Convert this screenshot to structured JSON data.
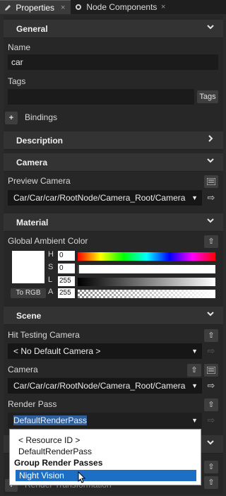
{
  "tabs": [
    {
      "icon": "wrench-icon",
      "label": "Properties",
      "close": "×"
    },
    {
      "icon": "settings-icon",
      "label": "Node Components",
      "close": "×"
    }
  ],
  "sections": {
    "general": "General",
    "description": "Description",
    "camera": "Camera",
    "material": "Material",
    "scene": "Scene"
  },
  "general": {
    "name_label": "Name",
    "name_value": "car",
    "tags_label": "Tags",
    "tags_value": "",
    "tags_button": "Tags",
    "bindings_add": "+",
    "bindings_label": "Bindings"
  },
  "camera": {
    "preview_label": "Preview Camera",
    "preview_value": "Car/Car/car/RootNode/Camera_Root/Camera"
  },
  "material": {
    "ambient_label": "Global Ambient Color",
    "to_rgb": "To RGB",
    "h_label": "H",
    "h_value": "0",
    "s_label": "S",
    "s_value": "0",
    "l_label": "L",
    "l_value": "255",
    "a_label": "A",
    "a_value": "255",
    "swatch_color": "#ffffff"
  },
  "scene": {
    "hit_label": "Hit Testing Camera",
    "hit_value": "< No Default Camera >",
    "camera_label": "Camera",
    "camera_value": "Car/Car/car/RootNode/Camera_Root/Camera",
    "render_label": "Render Pass",
    "render_value": "DefaultRenderPass",
    "transform_add": "+",
    "transform_label": "Render Transformation"
  },
  "popup": {
    "resource": "< Resource ID >",
    "default_pass": "DefaultRenderPass",
    "group": "Group Render Passes",
    "night": "Night Vision"
  },
  "icons": {
    "chevron_down": "⌄",
    "chevron_right": "›",
    "dropdown": "▼",
    "link": "⇨",
    "upload": "⇧",
    "list": "▤"
  },
  "colors": {
    "accent": "#1c6fc4",
    "panel": "#272727",
    "header": "#333333"
  }
}
